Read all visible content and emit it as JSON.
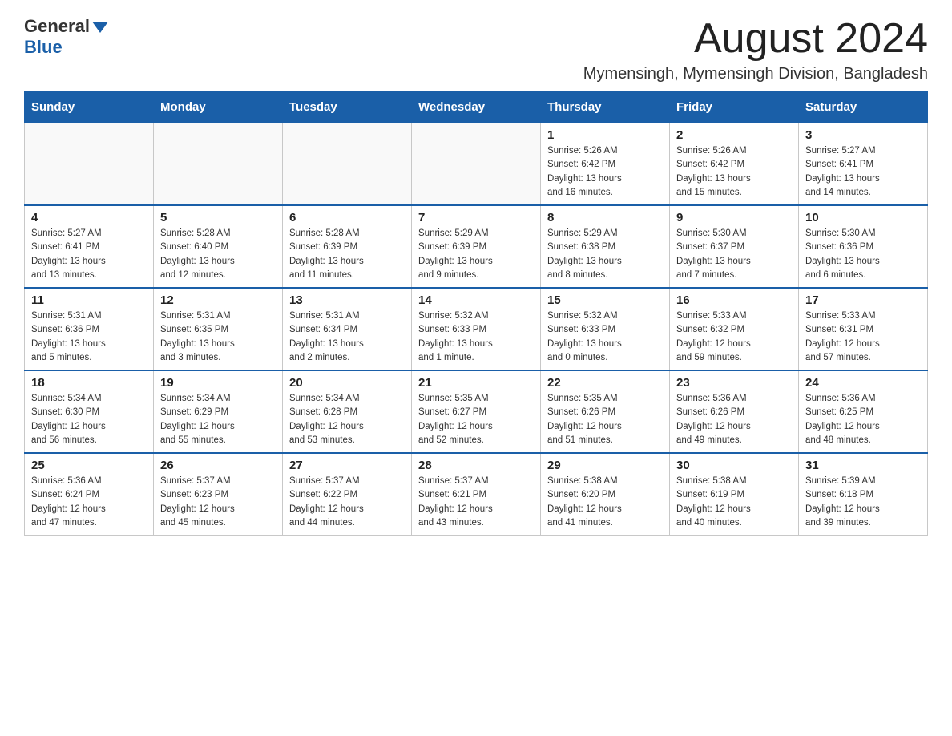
{
  "header": {
    "logo": {
      "general": "General",
      "blue": "Blue"
    },
    "title": "August 2024",
    "subtitle": "Mymensingh, Mymensingh Division, Bangladesh"
  },
  "calendar": {
    "days_of_week": [
      "Sunday",
      "Monday",
      "Tuesday",
      "Wednesday",
      "Thursday",
      "Friday",
      "Saturday"
    ],
    "weeks": [
      [
        {
          "day": "",
          "info": ""
        },
        {
          "day": "",
          "info": ""
        },
        {
          "day": "",
          "info": ""
        },
        {
          "day": "",
          "info": ""
        },
        {
          "day": "1",
          "info": "Sunrise: 5:26 AM\nSunset: 6:42 PM\nDaylight: 13 hours\nand 16 minutes."
        },
        {
          "day": "2",
          "info": "Sunrise: 5:26 AM\nSunset: 6:42 PM\nDaylight: 13 hours\nand 15 minutes."
        },
        {
          "day": "3",
          "info": "Sunrise: 5:27 AM\nSunset: 6:41 PM\nDaylight: 13 hours\nand 14 minutes."
        }
      ],
      [
        {
          "day": "4",
          "info": "Sunrise: 5:27 AM\nSunset: 6:41 PM\nDaylight: 13 hours\nand 13 minutes."
        },
        {
          "day": "5",
          "info": "Sunrise: 5:28 AM\nSunset: 6:40 PM\nDaylight: 13 hours\nand 12 minutes."
        },
        {
          "day": "6",
          "info": "Sunrise: 5:28 AM\nSunset: 6:39 PM\nDaylight: 13 hours\nand 11 minutes."
        },
        {
          "day": "7",
          "info": "Sunrise: 5:29 AM\nSunset: 6:39 PM\nDaylight: 13 hours\nand 9 minutes."
        },
        {
          "day": "8",
          "info": "Sunrise: 5:29 AM\nSunset: 6:38 PM\nDaylight: 13 hours\nand 8 minutes."
        },
        {
          "day": "9",
          "info": "Sunrise: 5:30 AM\nSunset: 6:37 PM\nDaylight: 13 hours\nand 7 minutes."
        },
        {
          "day": "10",
          "info": "Sunrise: 5:30 AM\nSunset: 6:36 PM\nDaylight: 13 hours\nand 6 minutes."
        }
      ],
      [
        {
          "day": "11",
          "info": "Sunrise: 5:31 AM\nSunset: 6:36 PM\nDaylight: 13 hours\nand 5 minutes."
        },
        {
          "day": "12",
          "info": "Sunrise: 5:31 AM\nSunset: 6:35 PM\nDaylight: 13 hours\nand 3 minutes."
        },
        {
          "day": "13",
          "info": "Sunrise: 5:31 AM\nSunset: 6:34 PM\nDaylight: 13 hours\nand 2 minutes."
        },
        {
          "day": "14",
          "info": "Sunrise: 5:32 AM\nSunset: 6:33 PM\nDaylight: 13 hours\nand 1 minute."
        },
        {
          "day": "15",
          "info": "Sunrise: 5:32 AM\nSunset: 6:33 PM\nDaylight: 13 hours\nand 0 minutes."
        },
        {
          "day": "16",
          "info": "Sunrise: 5:33 AM\nSunset: 6:32 PM\nDaylight: 12 hours\nand 59 minutes."
        },
        {
          "day": "17",
          "info": "Sunrise: 5:33 AM\nSunset: 6:31 PM\nDaylight: 12 hours\nand 57 minutes."
        }
      ],
      [
        {
          "day": "18",
          "info": "Sunrise: 5:34 AM\nSunset: 6:30 PM\nDaylight: 12 hours\nand 56 minutes."
        },
        {
          "day": "19",
          "info": "Sunrise: 5:34 AM\nSunset: 6:29 PM\nDaylight: 12 hours\nand 55 minutes."
        },
        {
          "day": "20",
          "info": "Sunrise: 5:34 AM\nSunset: 6:28 PM\nDaylight: 12 hours\nand 53 minutes."
        },
        {
          "day": "21",
          "info": "Sunrise: 5:35 AM\nSunset: 6:27 PM\nDaylight: 12 hours\nand 52 minutes."
        },
        {
          "day": "22",
          "info": "Sunrise: 5:35 AM\nSunset: 6:26 PM\nDaylight: 12 hours\nand 51 minutes."
        },
        {
          "day": "23",
          "info": "Sunrise: 5:36 AM\nSunset: 6:26 PM\nDaylight: 12 hours\nand 49 minutes."
        },
        {
          "day": "24",
          "info": "Sunrise: 5:36 AM\nSunset: 6:25 PM\nDaylight: 12 hours\nand 48 minutes."
        }
      ],
      [
        {
          "day": "25",
          "info": "Sunrise: 5:36 AM\nSunset: 6:24 PM\nDaylight: 12 hours\nand 47 minutes."
        },
        {
          "day": "26",
          "info": "Sunrise: 5:37 AM\nSunset: 6:23 PM\nDaylight: 12 hours\nand 45 minutes."
        },
        {
          "day": "27",
          "info": "Sunrise: 5:37 AM\nSunset: 6:22 PM\nDaylight: 12 hours\nand 44 minutes."
        },
        {
          "day": "28",
          "info": "Sunrise: 5:37 AM\nSunset: 6:21 PM\nDaylight: 12 hours\nand 43 minutes."
        },
        {
          "day": "29",
          "info": "Sunrise: 5:38 AM\nSunset: 6:20 PM\nDaylight: 12 hours\nand 41 minutes."
        },
        {
          "day": "30",
          "info": "Sunrise: 5:38 AM\nSunset: 6:19 PM\nDaylight: 12 hours\nand 40 minutes."
        },
        {
          "day": "31",
          "info": "Sunrise: 5:39 AM\nSunset: 6:18 PM\nDaylight: 12 hours\nand 39 minutes."
        }
      ]
    ]
  }
}
